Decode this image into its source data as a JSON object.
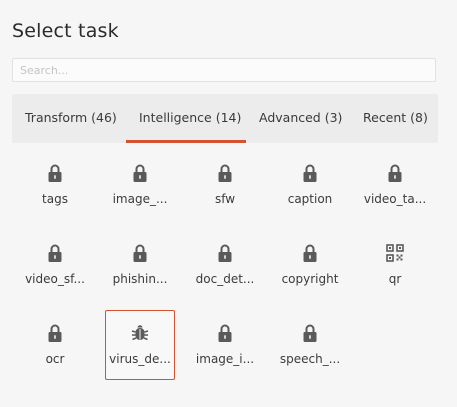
{
  "title": "Select task",
  "search": {
    "placeholder": "Search..."
  },
  "tabs": [
    {
      "label": "Transform (46)"
    },
    {
      "label": "Intelligence (14)"
    },
    {
      "label": "Advanced (3)"
    },
    {
      "label": "Recent (8)"
    }
  ],
  "active_tab": "Intelligence (14)",
  "accent_color": "#d5512f",
  "tasks": [
    {
      "label": "tags",
      "icon": "lock-icon"
    },
    {
      "label": "image_...",
      "icon": "lock-icon"
    },
    {
      "label": "sfw",
      "icon": "lock-icon"
    },
    {
      "label": "caption",
      "icon": "lock-icon"
    },
    {
      "label": "video_ta...",
      "icon": "lock-icon"
    },
    {
      "label": "video_sf...",
      "icon": "lock-icon"
    },
    {
      "label": "phishin...",
      "icon": "lock-icon"
    },
    {
      "label": "doc_det...",
      "icon": "lock-icon"
    },
    {
      "label": "copyright",
      "icon": "lock-icon"
    },
    {
      "label": "qr",
      "icon": "qr-code-icon"
    },
    {
      "label": "ocr",
      "icon": "lock-icon"
    },
    {
      "label": "virus_de...",
      "icon": "bug-icon",
      "selected": true
    },
    {
      "label": "image_i...",
      "icon": "lock-icon"
    },
    {
      "label": "speech_...",
      "icon": "lock-icon"
    }
  ]
}
